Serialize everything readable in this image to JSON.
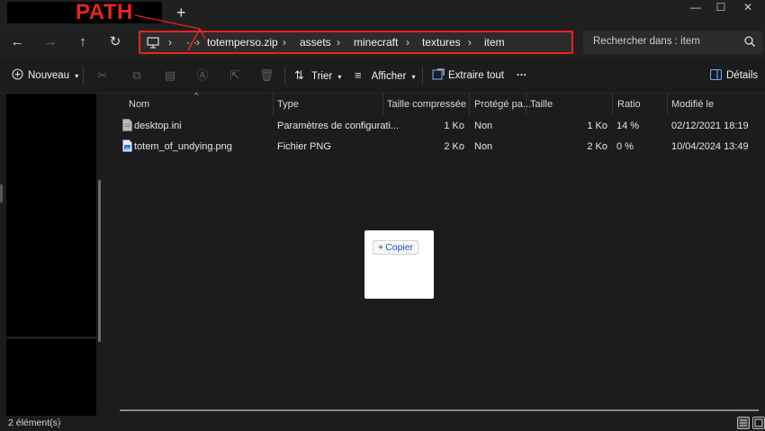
{
  "titlebar": {
    "annotation_label": "PATH",
    "new_tab": "+",
    "minimize": "—",
    "maximize": "☐",
    "close": "✕"
  },
  "nav": {
    "back": "←",
    "forward": "→",
    "up": "↑",
    "refresh": "↻"
  },
  "address": {
    "computer_icon": "monitor-icon",
    "more": "···",
    "segments": [
      "totemperso.zip",
      "assets",
      "minecraft",
      "textures",
      "item"
    ],
    "separator": "›"
  },
  "search": {
    "placeholder": "Rechercher dans : item"
  },
  "toolbar": {
    "new_label": "Nouveau",
    "sort_label": "Trier",
    "view_label": "Afficher",
    "extract_label": "Extraire tout",
    "more": "···",
    "details_label": "Détails"
  },
  "columns": {
    "name": "Nom",
    "type": "Type",
    "compressed_size": "Taille compressée",
    "protected": "Protégé pa...",
    "size": "Taille",
    "ratio": "Ratio",
    "modified": "Modifié le"
  },
  "files": [
    {
      "name": "desktop.ini",
      "type": "Paramètres de configurati...",
      "compressed_size": "1 Ko",
      "protected": "Non",
      "size": "1 Ko",
      "ratio": "14 %",
      "modified": "02/12/2021 18:19",
      "icon": "ini-file-icon"
    },
    {
      "name": "totem_of_undying.png",
      "type": "Fichier PNG",
      "compressed_size": "2 Ko",
      "protected": "Non",
      "size": "2 Ko",
      "ratio": "0 %",
      "modified": "10/04/2024 13:49",
      "icon": "png-file-icon"
    }
  ],
  "popup": {
    "copy_label": "Copier",
    "plus": "+"
  },
  "status": {
    "count": "2 élément(s)"
  },
  "colors": {
    "annotation": "#e8241f",
    "background": "#1c1c1c",
    "link_blue": "#1a56c4"
  }
}
